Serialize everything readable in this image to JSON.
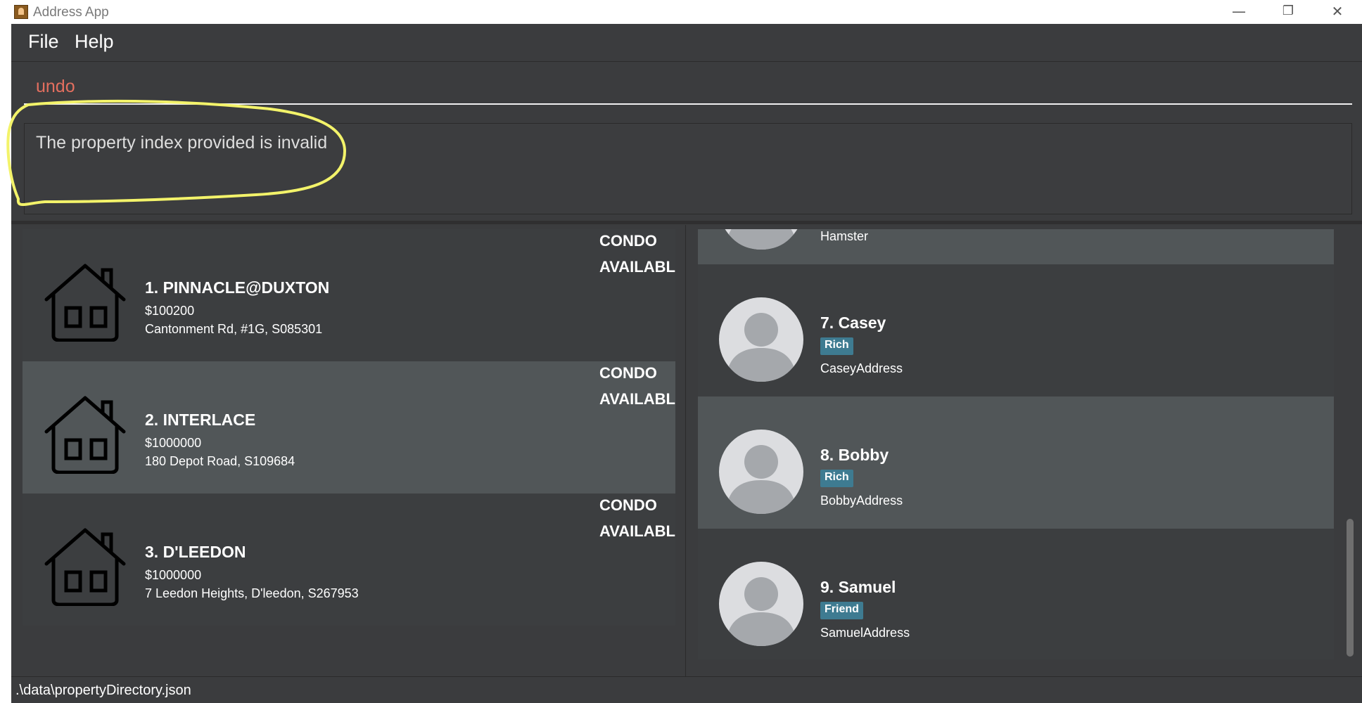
{
  "window": {
    "title": "Address App",
    "minimize": "—",
    "restore": "❐",
    "close": "✕"
  },
  "menu": {
    "file": "File",
    "help": "Help"
  },
  "command": {
    "input_value": "undo",
    "result": "The property index provided is invalid"
  },
  "properties": [
    {
      "name": "1.  PINNACLE@DUXTON",
      "price": "$100200",
      "address": "Cantonment Rd, #1G, S085301",
      "type": "CONDO",
      "status": "AVAILABLE"
    },
    {
      "name": "2.  INTERLACE",
      "price": "$1000000",
      "address": "180 Depot Road, S109684",
      "type": "CONDO",
      "status": "AVAILABLE"
    },
    {
      "name": "3.  D'LEEDON",
      "price": "$1000000",
      "address": "7 Leedon Heights, D'leedon, S267953",
      "type": "CONDO",
      "status": "AVAILABLE"
    }
  ],
  "buyers": [
    {
      "name": "",
      "tag": "",
      "address": "Hamster"
    },
    {
      "name": "7.  Casey",
      "tag": "Rich",
      "address": "CaseyAddress"
    },
    {
      "name": "8.  Bobby",
      "tag": "Rich",
      "address": "BobbyAddress"
    },
    {
      "name": "9.  Samuel",
      "tag": "Friend",
      "address": "SamuelAddress"
    }
  ],
  "status": {
    "path": ".\\data\\propertyDirectory.json"
  },
  "colors": {
    "background": "#3b3c3e",
    "card_alt": "#515658",
    "tag": "#3e7b91",
    "command_text": "#e36f5f",
    "annotation": "#f3f36a"
  },
  "icons": {
    "app": "address-app-icon",
    "property": "house-icon",
    "buyer": "avatar-icon"
  }
}
